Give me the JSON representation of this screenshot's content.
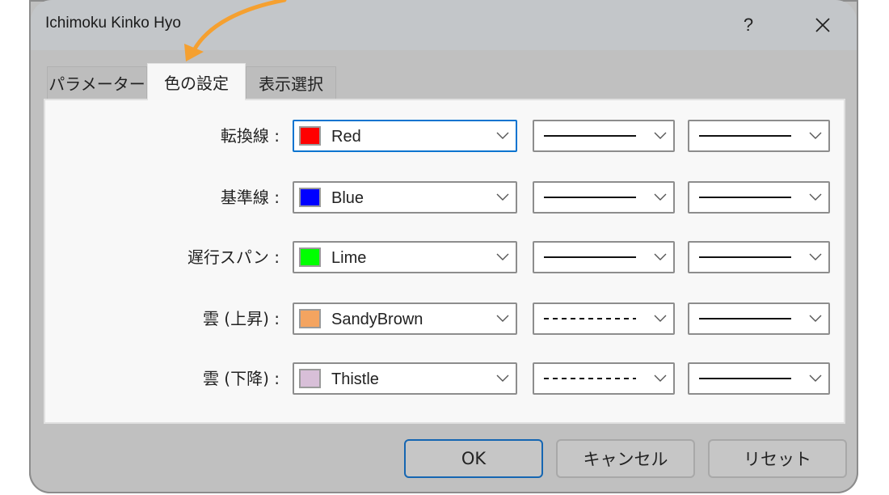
{
  "window": {
    "title": "Ichimoku Kinko Hyo",
    "help_label": "?",
    "close_icon": "close-icon"
  },
  "tabs": [
    {
      "label": "パラメーター",
      "active": false
    },
    {
      "label": "色の設定",
      "active": true
    },
    {
      "label": "表示選択",
      "active": false
    }
  ],
  "rows": [
    {
      "label": "転換線 :",
      "color_name": "Red",
      "color": "#ff0000",
      "line_style": "solid",
      "line_width": "solid-thin",
      "focused": true
    },
    {
      "label": "基準線 :",
      "color_name": "Blue",
      "color": "#0000ff",
      "line_style": "solid",
      "line_width": "solid-thin",
      "focused": false
    },
    {
      "label": "遅行スパン :",
      "color_name": "Lime",
      "color": "#00ff00",
      "line_style": "solid",
      "line_width": "solid-thin",
      "focused": false
    },
    {
      "label": "雲 (上昇) :",
      "color_name": "SandyBrown",
      "color": "#f4a460",
      "line_style": "dashed",
      "line_width": "solid-thin",
      "focused": false
    },
    {
      "label": "雲 (下降) :",
      "color_name": "Thistle",
      "color": "#d8bfd8",
      "line_style": "dashed",
      "line_width": "solid-thin",
      "focused": false
    }
  ],
  "buttons": {
    "ok": "OK",
    "cancel": "キャンセル",
    "reset": "リセット"
  },
  "annotation": {
    "arrow_color": "#f5a030",
    "points_to": "色の設定"
  }
}
